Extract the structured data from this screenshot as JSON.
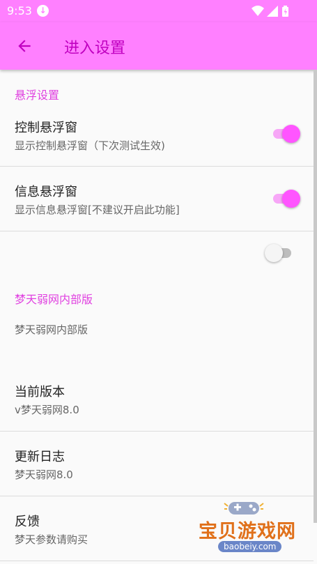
{
  "status_bar": {
    "time": "9:53",
    "icons": [
      "download-icon",
      "wifi-icon",
      "signal-icon",
      "battery-icon"
    ]
  },
  "app_bar": {
    "title": "进入设置",
    "back_icon": "arrow-left-icon"
  },
  "colors": {
    "accent": "#ff80ff",
    "accent_dark": "#c000c0",
    "switch_on": "#ff55ff",
    "category_text": "#e040e0"
  },
  "sections": {
    "float": {
      "header": "悬浮设置",
      "control_window": {
        "title": "控制悬浮窗",
        "summary": "显示控制悬浮窗（下次测试生效)",
        "enabled": true
      },
      "info_window": {
        "title": "信息悬浮窗",
        "summary": "显示信息悬浮窗[不建议开启此功能]",
        "enabled": true
      },
      "blank_switch": {
        "enabled": false
      }
    },
    "internal": {
      "header": "梦天弱网内部版",
      "label": "梦天弱网内部版",
      "current_version": {
        "title": "当前版本",
        "summary": "v梦天弱网8.0"
      },
      "changelog": {
        "title": "更新日志",
        "summary": "梦天弱网8.0"
      },
      "feedback": {
        "title": "反馈",
        "summary": "梦天参数请购买"
      }
    }
  },
  "watermark": {
    "text": "宝贝游戏网",
    "url": "baobeiy.com"
  }
}
